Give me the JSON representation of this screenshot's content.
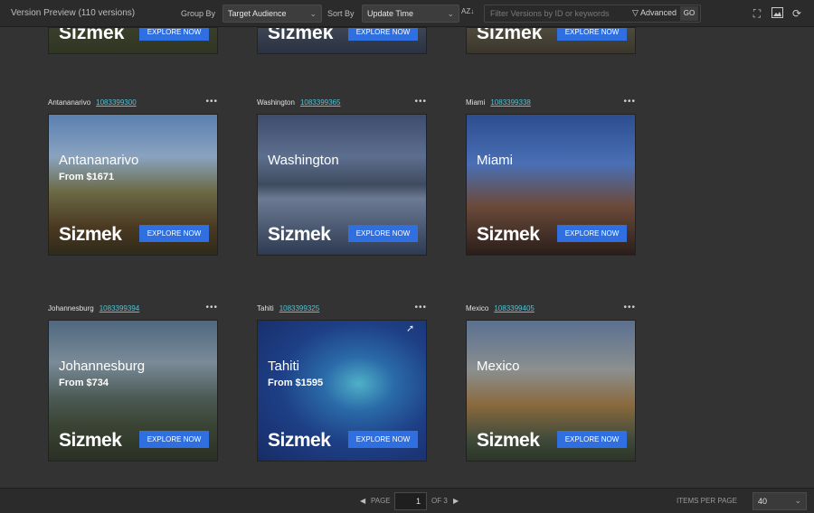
{
  "header": {
    "title": "Version Preview (110 versions)",
    "group_by_label": "Group By",
    "group_by_value": "Target Audience",
    "sort_by_label": "Sort By",
    "sort_by_value": "Update Time",
    "sort_toggle": "AZ↓",
    "filter_placeholder": "Filter Versions by ID or keywords",
    "advanced_label": "Advanced",
    "go_label": "GO"
  },
  "cards_top_partial": [
    {
      "cta": "EXPLORE NOW",
      "logo": "Sizmek"
    },
    {
      "cta": "EXPLORE NOW",
      "logo": "Sizmek"
    },
    {
      "cta": "EXPLORE NOW",
      "logo": "Sizmek"
    }
  ],
  "cards": [
    {
      "name": "Antananarivo",
      "id": "1083399300",
      "city": "Antananarivo",
      "price": "From $1671",
      "logo": "Sizmek",
      "cta": "EXPLORE NOW"
    },
    {
      "name": "Washington",
      "id": "1083399365",
      "city": "Washington",
      "price": "",
      "logo": "Sizmek",
      "cta": "EXPLORE NOW"
    },
    {
      "name": "Miami",
      "id": "1083399338",
      "city": "Miami",
      "price": "",
      "logo": "Sizmek",
      "cta": "EXPLORE NOW"
    },
    {
      "name": "Johannesburg",
      "id": "1083399394",
      "city": "Johannesburg",
      "price": "From $734",
      "logo": "Sizmek",
      "cta": "EXPLORE NOW"
    },
    {
      "name": "Tahiti",
      "id": "1083399325",
      "city": "Tahiti",
      "price": "From $1595",
      "logo": "Sizmek",
      "cta": "EXPLORE NOW"
    },
    {
      "name": "Mexico",
      "id": "1083399405",
      "city": "Mexico",
      "price": "",
      "logo": "Sizmek",
      "cta": "EXPLORE NOW"
    }
  ],
  "pagination": {
    "page_label": "PAGE",
    "page_value": "1",
    "of_label": "OF 3",
    "items_per_page_label": "ITEMS PER PAGE",
    "items_per_page_value": "40"
  },
  "colors": {
    "accent": "#2f6fe0",
    "id_link": "#53c3d6",
    "background": "#333333"
  },
  "icons": [
    "fullscreen-icon",
    "image-icon",
    "refresh-icon",
    "filter-funnel-icon",
    "chevron-down-icon",
    "caret-left-icon",
    "caret-right-icon",
    "more-icon"
  ]
}
